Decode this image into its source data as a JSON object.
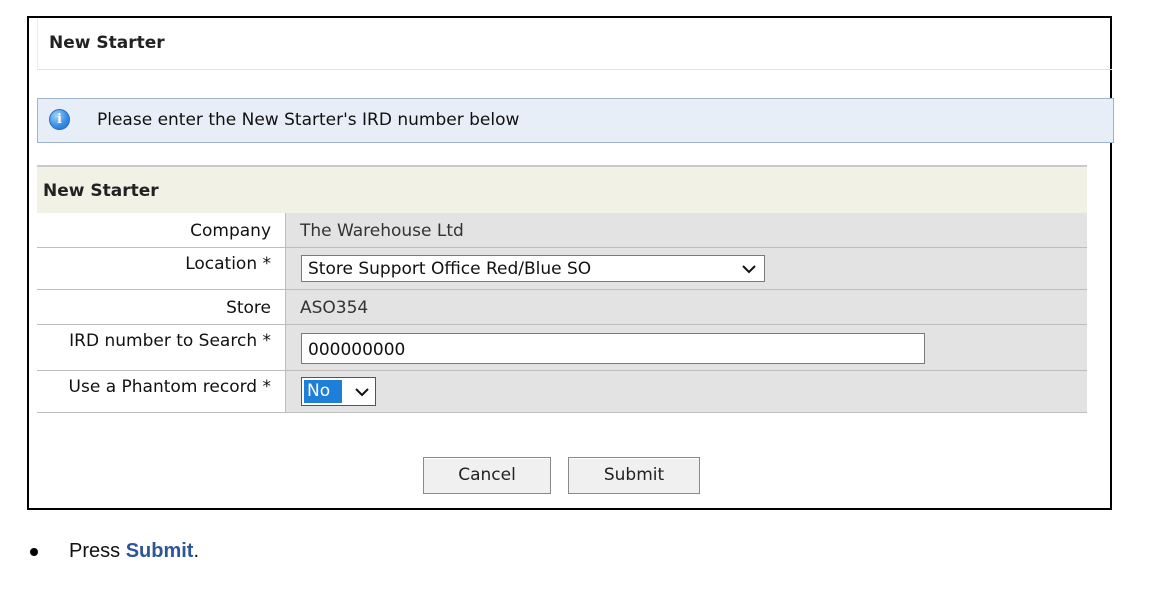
{
  "page": {
    "title": "New Starter"
  },
  "info_banner": {
    "icon": "info-icon",
    "message": "Please enter the New Starter's IRD number below"
  },
  "form": {
    "section_title": "New Starter",
    "company": {
      "label": "Company",
      "value": "The Warehouse Ltd"
    },
    "location": {
      "label": "Location *",
      "value": "Store Support Office Red/Blue SO"
    },
    "store": {
      "label": "Store",
      "value": "ASO354"
    },
    "ird": {
      "label": "IRD number to Search *",
      "value": "000000000"
    },
    "phantom": {
      "label": "Use a Phantom record *",
      "value": "No"
    }
  },
  "buttons": {
    "cancel": "Cancel",
    "submit": "Submit"
  },
  "instruction": {
    "prefix": "Press ",
    "action": "Submit",
    "suffix": "."
  },
  "colors": {
    "banner_bg": "#e8eef7",
    "section_bg": "#f1f1e6",
    "value_bg": "#e3e3e3",
    "selection_highlight": "#1e7fd8",
    "instruction_accent": "#2e5597"
  }
}
